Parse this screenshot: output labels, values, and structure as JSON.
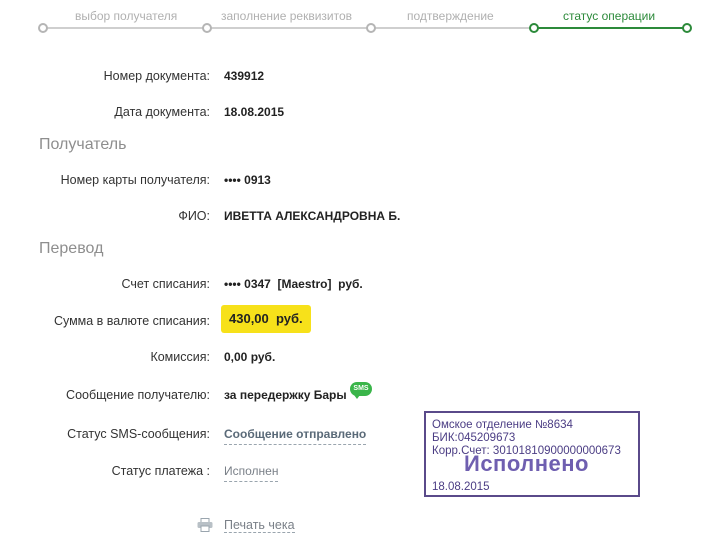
{
  "steps": [
    {
      "label": "выбор получателя",
      "active": false
    },
    {
      "label": "заполнение реквизитов",
      "active": false
    },
    {
      "label": "подтверждение",
      "active": false
    },
    {
      "label": "статус операции",
      "active": true
    }
  ],
  "document": {
    "number_label": "Номер документа:",
    "number_value": "439912",
    "date_label": "Дата документа:",
    "date_value": "18.08.2015"
  },
  "recipient": {
    "section_title": "Получатель",
    "card_label": "Номер карты получателя:",
    "card_value": "•••• 0913",
    "name_label": "ФИО:",
    "name_value": "ИВЕТТА АЛЕКСАНДРОВНА Б."
  },
  "transfer": {
    "section_title": "Перевод",
    "account_label": "Счет списания:",
    "account_value": "•••• 0347  [Maestro]  руб.",
    "amount_label": "Сумма в валюте списания:",
    "amount_value": "430,00  руб.",
    "fee_label": "Комиссия:",
    "fee_value": "0,00 руб.",
    "message_label": "Сообщение получателю:",
    "message_value": "за передержку Бары",
    "sms_icon": "SMS",
    "sms_status_label": "Статус SMS-сообщения:",
    "sms_status_value": "Сообщение отправлено",
    "payment_status_label": "Статус платежа :",
    "payment_status_value": "Исполнен"
  },
  "stamp": {
    "line1": "Омское отделение №8634",
    "line2": "БИК:045209673",
    "line3": "Корр.Счет: 30101810900000000673",
    "status": "Исполнено",
    "date": "18.08.2015"
  },
  "print": {
    "label": "Печать чека",
    "icon": "printer-icon"
  },
  "colors": {
    "accent": "#2c8a3a",
    "highlight": "#f7e11a",
    "stamp": "#4b3d84"
  }
}
